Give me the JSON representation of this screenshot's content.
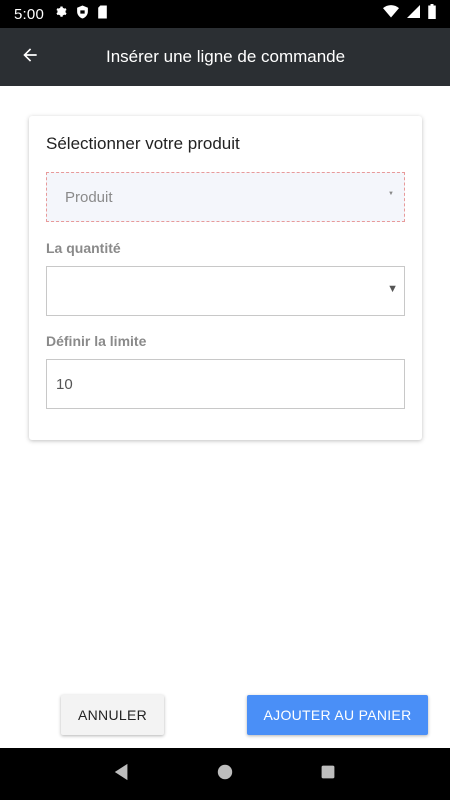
{
  "status_bar": {
    "time": "5:00",
    "left_icons": [
      "gear-icon",
      "shield-icon",
      "sd-card-icon"
    ],
    "right_icons": [
      "wifi-icon",
      "signal-icon",
      "battery-icon"
    ]
  },
  "app_bar": {
    "title": "Insérer une ligne de commande",
    "back_icon": "arrow-left-icon"
  },
  "form": {
    "card_title": "Sélectionner votre produit",
    "product_select": {
      "placeholder": "Produit"
    },
    "quantity": {
      "label": "La quantité",
      "value": ""
    },
    "limit": {
      "label": "Définir la limite",
      "value": "10"
    }
  },
  "actions": {
    "cancel_label": "ANNULER",
    "add_label": "AJOUTER AU PANIER"
  },
  "colors": {
    "app_bar": "#2b2f33",
    "primary_button": "#4a8ff7",
    "status_bar": "#000000"
  },
  "nav_bar": {
    "icons": [
      "back-triangle-icon",
      "home-circle-icon",
      "recents-square-icon"
    ]
  }
}
